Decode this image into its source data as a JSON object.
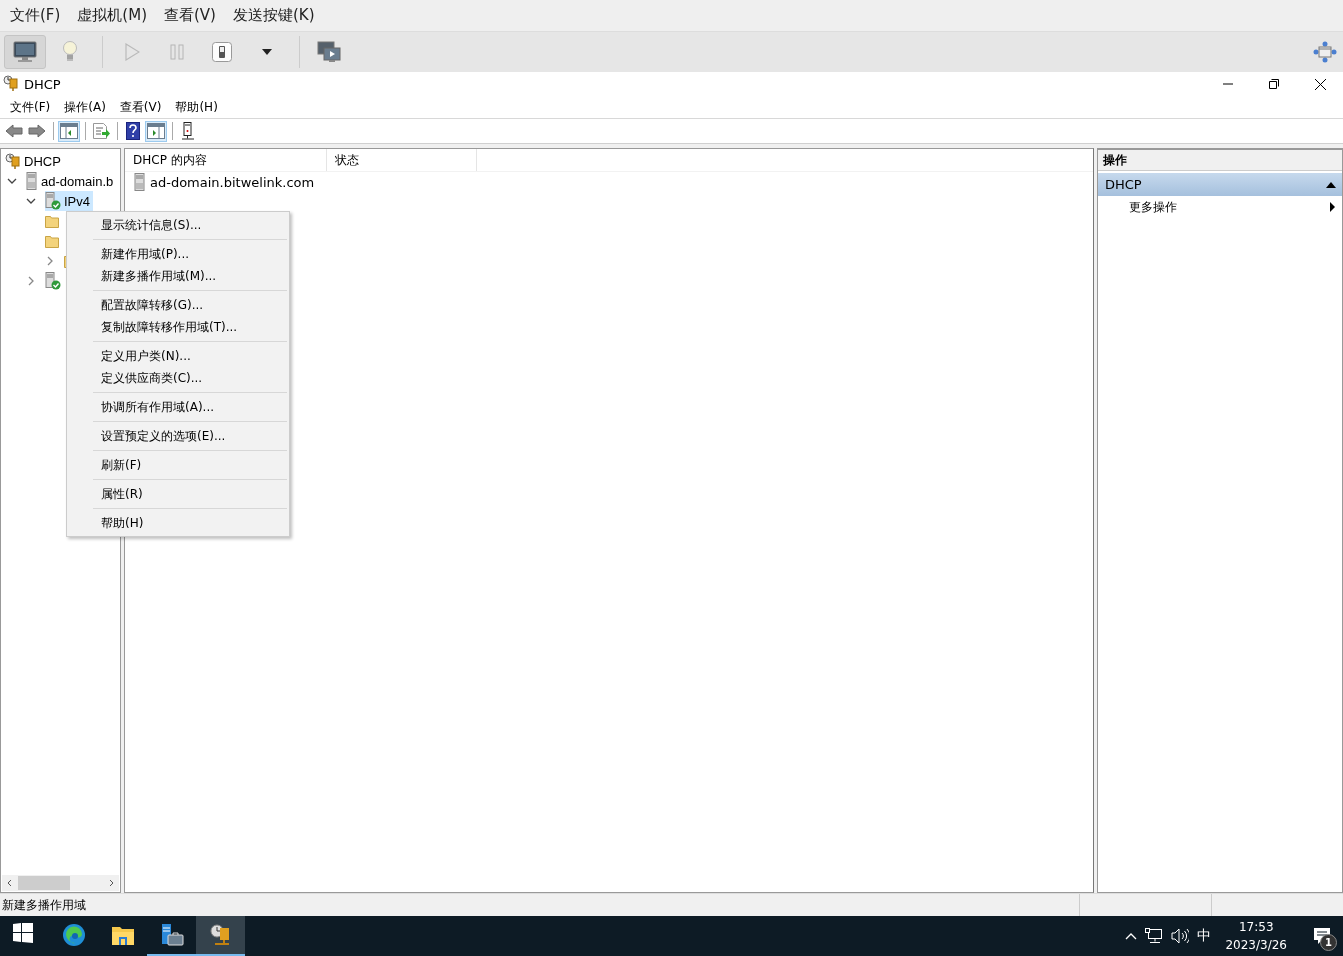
{
  "vm_menu": [
    "文件(F)",
    "虚拟机(M)",
    "查看(V)",
    "发送按键(K)"
  ],
  "vm_toolbar": [
    {
      "kind": "monitor",
      "pressed": true,
      "disabled": false
    },
    {
      "kind": "bulb",
      "pressed": false,
      "disabled": false
    },
    {
      "kind": "sep"
    },
    {
      "kind": "play",
      "pressed": false,
      "disabled": true
    },
    {
      "kind": "pause",
      "pressed": false,
      "disabled": true
    },
    {
      "kind": "switch",
      "pressed": false,
      "disabled": false
    },
    {
      "kind": "dropdown",
      "pressed": false,
      "disabled": false
    },
    {
      "kind": "sep"
    },
    {
      "kind": "screens",
      "pressed": false,
      "disabled": false
    }
  ],
  "window": {
    "title": "DHCP"
  },
  "menu": [
    "文件(F)",
    "操作(A)",
    "查看(V)",
    "帮助(H)"
  ],
  "toolbar": [
    {
      "kind": "back",
      "pressed": false
    },
    {
      "kind": "forward",
      "pressed": false
    },
    {
      "kind": "sep"
    },
    {
      "kind": "tree",
      "pressed": true
    },
    {
      "kind": "sep"
    },
    {
      "kind": "export",
      "pressed": false
    },
    {
      "kind": "sep"
    },
    {
      "kind": "help",
      "pressed": false
    },
    {
      "kind": "actionpane",
      "pressed": true
    },
    {
      "kind": "sep"
    },
    {
      "kind": "server",
      "pressed": false
    }
  ],
  "tree": [
    {
      "label": "DHCP",
      "kind": "dhcp",
      "selected": false,
      "children": [
        {
          "label": "ad-domain.b",
          "kind": "server",
          "expanded": true,
          "selected": false,
          "children": [
            {
              "label": "IPv4",
              "kind": "serverok",
              "expanded": true,
              "selected": true,
              "children": [
                {
                  "kind": "folder",
                  "selected": false
                },
                {
                  "kind": "folder",
                  "selected": false
                },
                {
                  "kind": "folder",
                  "expanded": false,
                  "selected": false
                }
              ]
            },
            {
              "kind": "serverok",
              "expanded": false,
              "selected": false
            }
          ]
        }
      ]
    }
  ],
  "context_menu": [
    [
      "显示统计信息(S)..."
    ],
    [
      "新建作用域(P)...",
      "新建多播作用域(M)..."
    ],
    [
      "配置故障转移(G)...",
      "复制故障转移作用域(T)..."
    ],
    [
      "定义用户类(N)...",
      "定义供应商类(C)..."
    ],
    [
      "协调所有作用域(A)..."
    ],
    [
      "设置预定义的选项(E)..."
    ],
    [
      "刷新(F)"
    ],
    [
      "属性(R)"
    ],
    [
      "帮助(H)"
    ]
  ],
  "table": {
    "columns": [
      "DHCP 的内容",
      "状态"
    ],
    "rows": [
      {
        "name": "ad-domain.bitwelink.com"
      }
    ]
  },
  "actions": {
    "title": "操作",
    "sections": [
      {
        "title": "DHCP",
        "expanded": true,
        "items": [
          "更多操作"
        ]
      }
    ]
  },
  "status_bar": "新建多播作用域",
  "taskbar": {
    "apps": [
      {
        "kind": "start",
        "running": false,
        "selected": false
      },
      {
        "kind": "edge",
        "running": false,
        "selected": false
      },
      {
        "kind": "explorer",
        "running": false,
        "selected": false
      },
      {
        "kind": "servermanager",
        "running": true,
        "selected": false
      },
      {
        "kind": "dhcp",
        "running": true,
        "selected": true
      }
    ],
    "ime": "中",
    "time": "17:53",
    "date": "2023/3/26",
    "notifications": "1"
  }
}
